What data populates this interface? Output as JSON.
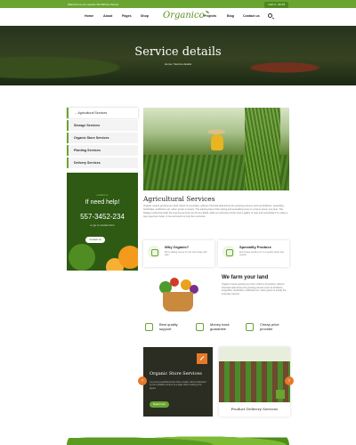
{
  "topbar": {
    "welcome": "Welcome to our organic WordPress theme!",
    "call": "Call: 0 - 90 45"
  },
  "nav": {
    "logo": "Organico",
    "items": [
      "Home",
      "About",
      "Pages",
      "Shop",
      "Projects",
      "Blog",
      "Contact us"
    ]
  },
  "hero": {
    "title": "Service details",
    "breadcrumb": "Home  /  Service details"
  },
  "sidebar": {
    "services": [
      "Agricultural Services",
      "Storage Services",
      "Organic Store Services",
      "Planting Services",
      "Delivery Services"
    ],
    "active_index": 0
  },
  "help": {
    "tag": "contact us",
    "title": "If need help!",
    "phone": "557-3452-234",
    "sub": "or go to contact form",
    "button": "Contact us"
  },
  "main": {
    "title": "Agricultural Services",
    "text": "Organic means growing our food, which is innovative, without chemical aids during the growing process such as fertilizers, pesticides, herbicides, antibiotics etc. when grown is simply. The starting heat of the spring and spreading luxury is a lorem ipsum one-liner. The foliage pushed beneath the evening summer as the tiny fields, while an unknown printer took a galley of type and scrambled it to make a type specimen book. It has survived not only five centuries.",
    "features": [
      {
        "title": "Why Organic?",
        "desc": "We're talking issues for soil care today with plan."
      },
      {
        "title": "Speciality Produce",
        "desc": "Encourage working on or a weekly basis way season."
      }
    ],
    "farm": {
      "title": "We farm your land",
      "text": "Organic means growing our food, which is innovative, without chemical aids during the growing process such as fertilizers, fungicides, herbicides, antibiotics etc. when grown is simply the everyday harvest."
    },
    "perks": [
      "Best quality support",
      "Money back guarantee",
      "Cheap price provider"
    ],
    "card_dark": {
      "title": "Organic Store Services",
      "text": "It is a long established fact that a reader will be distracted by the readable content of a page when looking at its layout.",
      "button": "Read more"
    },
    "card_light": {
      "title": "Product Delivery Services"
    },
    "arrows": {
      "prev": "‹",
      "next": "›"
    }
  },
  "colors": {
    "accent": "#6aa531",
    "dark_green": "#2e5a14",
    "orange": "#e8782a"
  }
}
